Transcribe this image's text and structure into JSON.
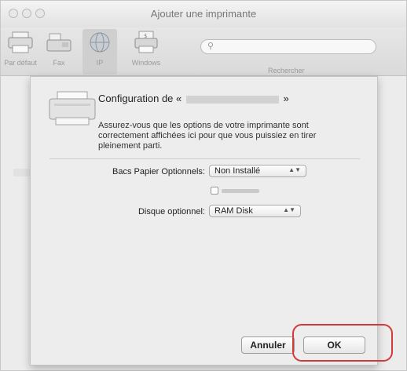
{
  "window": {
    "title": "Ajouter une imprimante"
  },
  "toolbar": {
    "items": [
      {
        "label": "Par défaut",
        "icon": "printer-icon"
      },
      {
        "label": "Fax",
        "icon": "fax-icon"
      },
      {
        "label": "IP",
        "icon": "globe-icon"
      },
      {
        "label": "Windows",
        "icon": "windows-printer-icon"
      }
    ],
    "active_index": 2,
    "search": {
      "placeholder": "",
      "label": "Rechercher"
    }
  },
  "sheet": {
    "title_prefix": "Configuration de «",
    "title_suffix": "»",
    "description": "Assurez-vous que les options de votre imprimante sont correctement affichées ici pour que vous puissiez en tirer pleinement parti.",
    "fields": [
      {
        "label": "Bacs Papier Optionnels:",
        "value": "Non Installé"
      },
      {
        "label": "Disque optionnel:",
        "value": "RAM Disk"
      }
    ],
    "checkbox_checked": false,
    "cancel_label": "Annuler",
    "ok_label": "OK"
  },
  "colors": {
    "highlight": "#d23a3a",
    "window_bg": "#ececec"
  }
}
